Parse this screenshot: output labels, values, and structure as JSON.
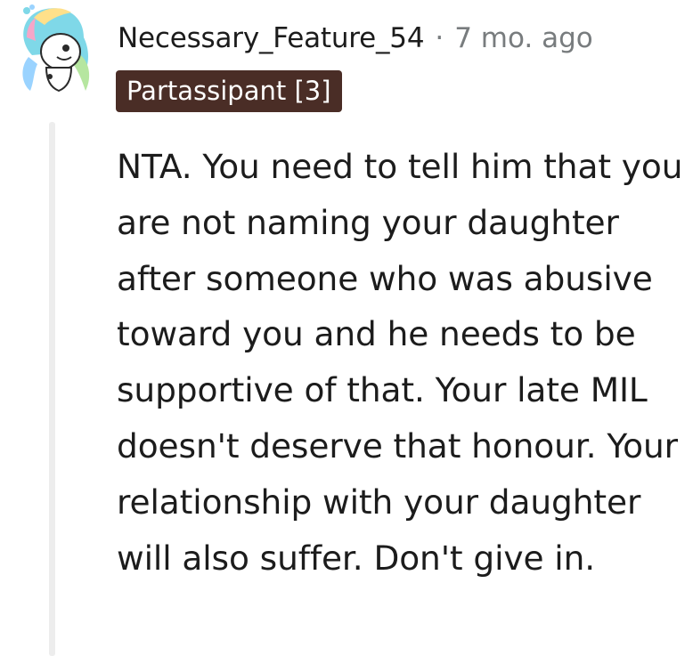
{
  "comment": {
    "username": "Necessary_Feature_54",
    "separator": "·",
    "timestamp": "7 mo. ago",
    "flair": "Partassipant [3]",
    "avatar_icon": "snoo-avatar-icon",
    "flair_color": "#4a2d26",
    "body": "NTA. You need to tell him that you are not naming your daughter after someone who was abusive toward you and he needs to be supportive of that. Your late MIL doesn't deserve that honour. Your relationship with your daughter will also suffer. Don't give in."
  }
}
